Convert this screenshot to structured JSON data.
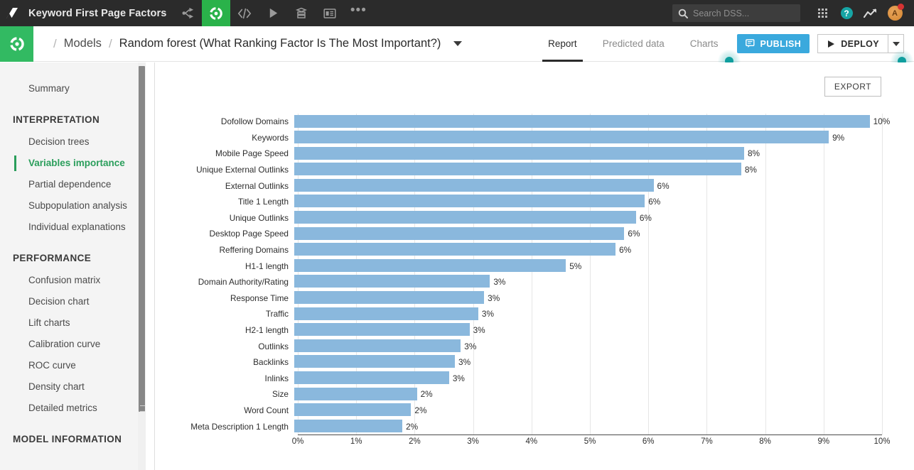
{
  "topbar": {
    "logo_icon": "dataiku-logo-icon",
    "project_title": "Keyword First Page Factors",
    "nav_icons": [
      {
        "name": "flow-icon",
        "label": "Flow",
        "active": false
      },
      {
        "name": "lab-model-icon",
        "label": "Lab",
        "active": true
      },
      {
        "name": "code-icon",
        "label": "Code",
        "active": false
      },
      {
        "name": "play-icon",
        "label": "Scenarios",
        "active": false
      },
      {
        "name": "database-icon",
        "label": "Datasets",
        "active": false
      },
      {
        "name": "dashboard-icon",
        "label": "Dashboards",
        "active": false
      },
      {
        "name": "more-dots-icon",
        "label": "More",
        "active": false
      }
    ],
    "search": {
      "icon": "search-icon",
      "placeholder": "Search DSS...",
      "value": ""
    },
    "apps_icon": "apps-grid-icon",
    "help_icon": "help-circle-icon",
    "help_glyph": "?",
    "trend_icon": "trend-up-icon",
    "avatar_initial": "A",
    "avatar_icon": "avatar-icon",
    "notification_badge": ""
  },
  "subbar": {
    "logo_icon": "project-logo-icon",
    "separator": "/",
    "breadcrumb_models": "Models",
    "breadcrumb_current": "Random forest (What Ranking Factor Is The Most Important?)",
    "breadcrumb_caret_icon": "chevron-down-icon",
    "tabs": [
      {
        "label": "Report",
        "active": true
      },
      {
        "label": "Predicted data",
        "active": false
      },
      {
        "label": "Charts",
        "active": false
      }
    ],
    "publish_label": "PUBLISH",
    "publish_icon": "publish-icon",
    "deploy_label": "DEPLOY",
    "deploy_icon": "play-triangle-icon",
    "deploy_caret_icon": "chevron-down-icon"
  },
  "sidebar": {
    "top_items": [
      {
        "label": "Summary",
        "active": false
      }
    ],
    "sections": [
      {
        "heading": "INTERPRETATION",
        "items": [
          {
            "label": "Decision trees",
            "active": false
          },
          {
            "label": "Variables importance",
            "active": true
          },
          {
            "label": "Partial dependence",
            "active": false
          },
          {
            "label": "Subpopulation analysis",
            "active": false
          },
          {
            "label": "Individual explanations",
            "active": false
          }
        ]
      },
      {
        "heading": "PERFORMANCE",
        "items": [
          {
            "label": "Confusion matrix",
            "active": false
          },
          {
            "label": "Decision chart",
            "active": false
          },
          {
            "label": "Lift charts",
            "active": false
          },
          {
            "label": "Calibration curve",
            "active": false
          },
          {
            "label": "ROC curve",
            "active": false
          },
          {
            "label": "Density chart",
            "active": false
          },
          {
            "label": "Detailed metrics",
            "active": false
          }
        ]
      },
      {
        "heading": "MODEL INFORMATION",
        "items": []
      }
    ]
  },
  "main": {
    "export_label": "EXPORT"
  },
  "colors": {
    "bar": "#8ab8dd",
    "accent_green": "#2a9e5b",
    "topbar_bg": "#2b2b2b",
    "publish_blue": "#3aa9dd",
    "hotspot_teal": "#0f9e9e",
    "sidebar_bg": "#f4f4f4"
  },
  "chart_data": {
    "type": "bar",
    "orientation": "horizontal",
    "title": "",
    "xlabel": "",
    "ylabel": "",
    "xlim": [
      0,
      10
    ],
    "grid": true,
    "legend": false,
    "value_suffix": "%",
    "xticks": [
      "0%",
      "1%",
      "2%",
      "3%",
      "4%",
      "5%",
      "6%",
      "7%",
      "8%",
      "9%",
      "10%"
    ],
    "xtick_values": [
      0,
      1,
      2,
      3,
      4,
      5,
      6,
      7,
      8,
      9,
      10
    ],
    "categories": [
      "Dofollow Domains",
      "Keywords",
      "Mobile Page Speed",
      "Unique External Outlinks",
      "External Outlinks",
      "Title 1 Length",
      "Unique Outlinks",
      "Desktop Page Speed",
      "Reffering Domains",
      "H1-1 length",
      "Domain Authority/Rating",
      "Response Time",
      "Traffic",
      "H2-1 length",
      "Outlinks",
      "Backlinks",
      "Inlinks",
      "Size",
      "Word Count",
      "Meta Description 1 Length"
    ],
    "values": [
      9.85,
      9.15,
      7.7,
      7.65,
      6.15,
      6.0,
      5.85,
      5.65,
      5.5,
      4.65,
      3.35,
      3.25,
      3.15,
      3.0,
      2.85,
      2.75,
      2.65,
      2.1,
      2.0,
      1.85
    ],
    "labels": [
      "10%",
      "9%",
      "8%",
      "8%",
      "6%",
      "6%",
      "6%",
      "6%",
      "6%",
      "5%",
      "3%",
      "3%",
      "3%",
      "3%",
      "3%",
      "3%",
      "3%",
      "2%",
      "2%",
      "2%"
    ]
  }
}
